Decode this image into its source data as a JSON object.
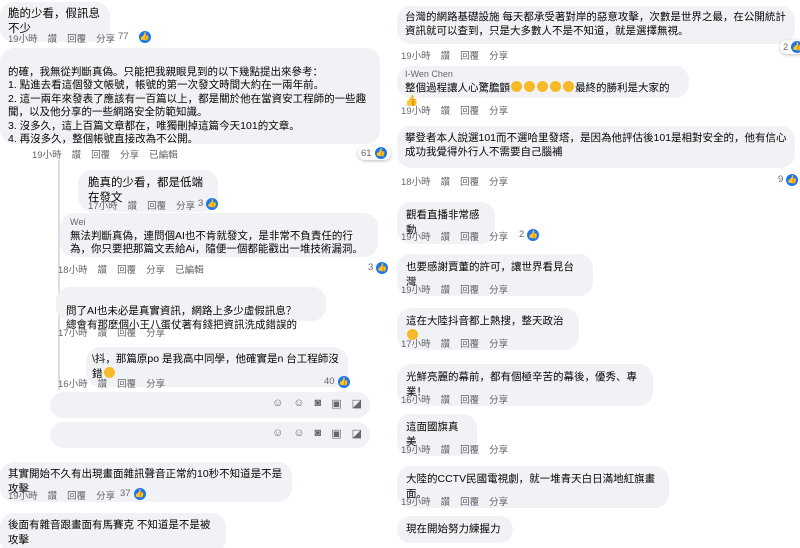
{
  "left": {
    "c1": {
      "text": "脆的少看，假訊息不少",
      "time": "19小時",
      "like": "讚",
      "reply": "回覆",
      "share": "分享",
      "count": "77"
    },
    "c2": {
      "text": "的確，我無從判斷真偽。只能把我親眼見到的以下幾點提出來參考：\n1. 點進去看這個發文帳號，帳號的第一次發文時間大約在一兩年前。\n2. 這一兩年來發表了應該有一百篇以上，都是關於他在當資安工程師的一些趣聞，以及他分享的一些網路安全防範知識。\n3. 沒多久，這上百篇文章都在，唯獨刪掉這篇今天101的文章。\n4. 再沒多久，整個帳號直接改為不公開。",
      "time": "19小時",
      "like": "讚",
      "reply": "回覆",
      "share": "分享",
      "edited": "已編輯",
      "count": "61"
    },
    "c3": {
      "text": "脆真的少看，都是低端在發文",
      "time": "17小時",
      "like": "讚",
      "reply": "回覆",
      "share": "分享",
      "count": "3"
    },
    "c4": {
      "name": "Wei",
      "text": "無法判斷真偽，連問個AI也不肯就發文，是非常不負責任的行為，你只要把那篇文丟給Ai，隨便一個都能戳出一堆技術漏洞。",
      "time": "18小時",
      "like": "讚",
      "reply": "回覆",
      "share": "分享",
      "edited": "已編輯",
      "count": "3"
    },
    "c5": {
      "text": "問了AI也未必是真實資訊，網路上多少虛假訊息？\n總會有那麼個小王八蛋仗著有錢把資訊洗成錯誤的",
      "time": "17小時",
      "like": "讚",
      "reply": "回覆",
      "share": "分享",
      "count": ""
    },
    "c6": {
      "text": "\\抖，那篇原po 是我高中同學，他確實是n 台工程師沒錯",
      "time": "16小時",
      "like": "讚",
      "reply": "回覆",
      "share": "分享",
      "count": "40"
    },
    "c7": {
      "text": "其實開始不久有出現畫面雜訊聲音正常約10秒不知道是不是攻擊",
      "time": "19小時",
      "like": "讚",
      "reply": "回覆",
      "share": "分享",
      "count": "37"
    },
    "c8": {
      "text": "後面有雜音跟畫面有馬賽克 不知道是不是被攻擊"
    }
  },
  "right": {
    "r1": {
      "text": "台灣的網路基礎設施 每天都承受著對岸的惡意攻擊，次數是世界之最，在公開統計資訊就可以查到，只是大多數人不是不知道，就是選擇無視。",
      "time": "19小時",
      "like": "讚",
      "reply": "回覆",
      "share": "分享",
      "count": "2"
    },
    "r2": {
      "name": "I-Wen Chen",
      "text": "整個過程讓人心驚膽顫",
      "tail": "最終的勝利是大家的",
      "time": "19小時",
      "like": "讚",
      "reply": "回覆",
      "share": "分享",
      "count": ""
    },
    "r3": {
      "text": "攀登者本人說選101而不選哈里發塔，是因為他評估後101是相對安全的，他有信心成功我覺得外行人不需要自己腦補",
      "time": "18小時",
      "like": "讚",
      "reply": "回覆",
      "share": "分享",
      "count": "9"
    },
    "r4": {
      "text": "觀看直播非常感動",
      "time": "19小時",
      "like": "讚",
      "reply": "回覆",
      "share": "分享",
      "count": "2"
    },
    "r5": {
      "text": "也要感謝賈董的許可，讓世界看見台灣",
      "time": "19小時",
      "like": "讚",
      "reply": "回覆",
      "share": "分享",
      "count": ""
    },
    "r6": {
      "text": "這在大陸抖音都上熱搜，整天政治",
      "time": "17小時",
      "like": "讚",
      "reply": "回覆",
      "share": "分享",
      "count": ""
    },
    "r7": {
      "text": "光鮮亮麗的幕前，都有個極辛苦的幕後，優秀、專業！",
      "time": "16小時",
      "like": "讚",
      "reply": "回覆",
      "share": "分享",
      "count": ""
    },
    "r8": {
      "text": "這面國旗真美",
      "time": "19小時",
      "like": "讚",
      "reply": "回覆",
      "share": "分享",
      "count": ""
    },
    "r9": {
      "text": "大陸的CCTV民國電視劇，就一堆青天白日滿地紅旗畫面。",
      "time": "19小時",
      "like": "讚",
      "reply": "回覆",
      "share": "分享",
      "count": ""
    },
    "r10": {
      "text": "現在開始努力練握力"
    }
  },
  "colors": {
    "bubble": "#f0f2f5",
    "meta": "#65676b",
    "like": "#1877f2"
  }
}
